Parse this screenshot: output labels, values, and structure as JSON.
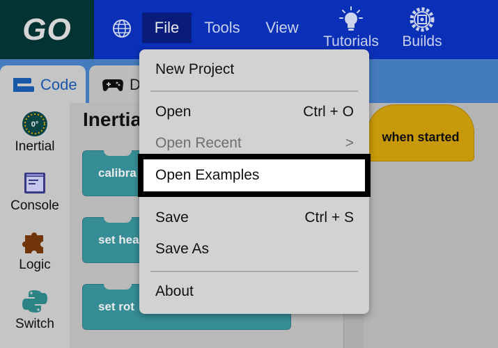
{
  "app": {
    "logo": "GO"
  },
  "menubar": {
    "file": "File",
    "tools": "Tools",
    "view": "View",
    "tutorials": "Tutorials",
    "builds": "Builds"
  },
  "tabs": {
    "code": "Code",
    "drive": "D"
  },
  "categories": [
    "Inertial",
    "Console",
    "Logic",
    "Switch"
  ],
  "inertial_badge": "0°",
  "flyout": {
    "title": "Inertia",
    "blocks": [
      "calibra",
      "set hea",
      "set rot"
    ]
  },
  "workspace": {
    "hat_block": "when started"
  },
  "file_menu": {
    "new_project": "New Project",
    "open": {
      "label": "Open",
      "shortcut": "Ctrl + O"
    },
    "open_recent": {
      "label": "Open Recent",
      "arrow": ">"
    },
    "open_examples": "Open Examples",
    "save": {
      "label": "Save",
      "shortcut": "Ctrl + S"
    },
    "save_as": "Save As",
    "about": "About"
  },
  "colors": {
    "topbar": "#0d35c8",
    "logo_bg": "#053838",
    "tabstrip": "#4a86cf",
    "motion_block": "#3b9aa3",
    "event_block": "#d9a60b"
  }
}
